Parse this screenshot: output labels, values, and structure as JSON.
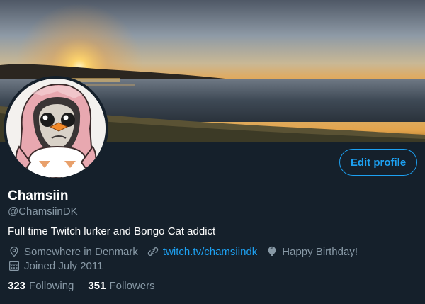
{
  "profile": {
    "display_name": "Chamsiin",
    "handle": "@ChamsiinDK",
    "bio": "Full time Twitch lurker and Bongo Cat addict",
    "location": "Somewhere in Denmark",
    "website": "twitch.tv/chamsiindk",
    "birthday": "Happy Birthday!",
    "joined": "Joined July 2011"
  },
  "actions": {
    "edit_profile_label": "Edit profile"
  },
  "stats": {
    "following_count": "323",
    "following_label": "Following",
    "followers_count": "351",
    "followers_label": "Followers"
  },
  "icons": {
    "location": "location-pin-icon",
    "website": "link-icon",
    "birthday": "balloon-icon",
    "joined": "calendar-icon"
  },
  "colors": {
    "background": "#15202b",
    "accent": "#1da1f2",
    "secondary_text": "#8899a6",
    "primary_text": "#ffffff"
  }
}
